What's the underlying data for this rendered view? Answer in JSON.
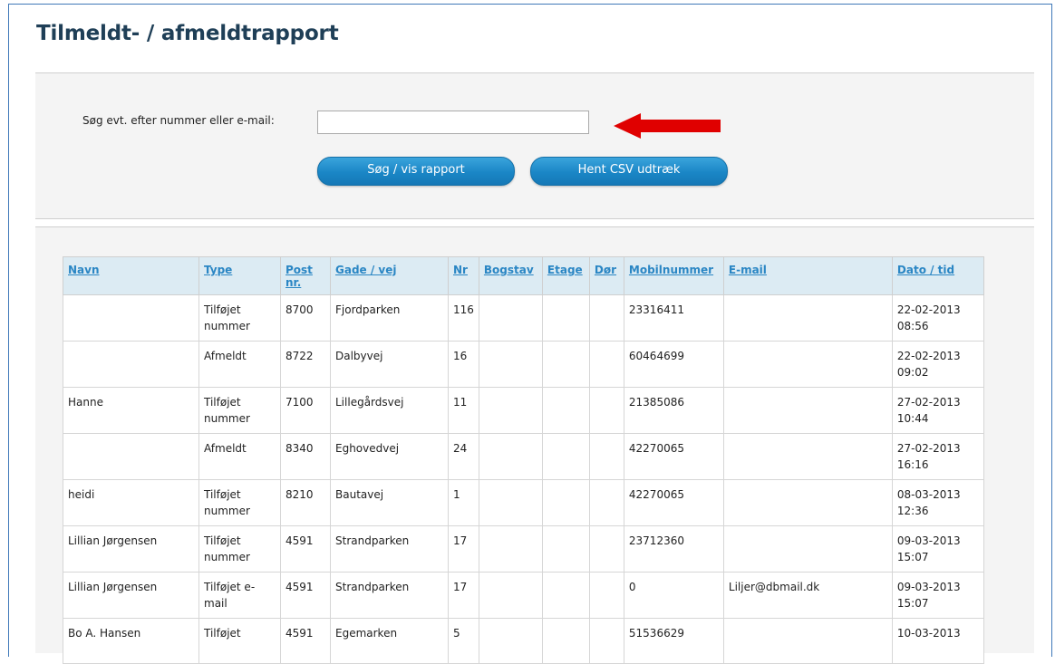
{
  "page": {
    "title": "Tilmeldt- / afmeldtrapport"
  },
  "search": {
    "label": "Søg evt. efter nummer eller e-mail:",
    "value": "",
    "placeholder": "",
    "search_button": "Søg / vis rapport",
    "csv_button": "Hent CSV udtræk"
  },
  "annotation": {
    "arrow_color": "#e00000",
    "icon": "red-arrow-left-icon"
  },
  "table": {
    "headers": [
      "Navn",
      "Type",
      "Post nr.",
      "Gade / vej",
      "Nr",
      "Bogstav",
      "Etage",
      "Dør",
      "Mobilnummer",
      "E-mail",
      "Dato / tid"
    ],
    "rows": [
      [
        "",
        "Tilføjet nummer",
        "8700",
        "Fjordparken",
        "116",
        "",
        "",
        "",
        "23316411",
        "",
        "22-02-2013 08:56"
      ],
      [
        "",
        "Afmeldt",
        "8722",
        "Dalbyvej",
        "16",
        "",
        "",
        "",
        "60464699",
        "",
        "22-02-2013 09:02"
      ],
      [
        "Hanne",
        "Tilføjet nummer",
        "7100",
        "Lillegårdsvej",
        "11",
        "",
        "",
        "",
        "21385086",
        "",
        "27-02-2013 10:44"
      ],
      [
        "",
        "Afmeldt",
        "8340",
        "Eghovedvej",
        "24",
        "",
        "",
        "",
        "42270065",
        "",
        "27-02-2013 16:16"
      ],
      [
        "heidi",
        "Tilføjet nummer",
        "8210",
        "Bautavej",
        "1",
        "",
        "",
        "",
        "42270065",
        "",
        "08-03-2013 12:36"
      ],
      [
        "Lillian Jørgensen",
        "Tilføjet nummer",
        "4591",
        "Strandparken",
        "17",
        "",
        "",
        "",
        "23712360",
        "",
        "09-03-2013 15:07"
      ],
      [
        "Lillian Jørgensen",
        "Tilføjet e-mail",
        "4591",
        "Strandparken",
        "17",
        "",
        "",
        "",
        "0",
        "Liljer@dbmail.dk",
        "09-03-2013 15:07"
      ],
      [
        "Bo A. Hansen",
        "Tilføjet",
        "4591",
        "Egemarken",
        "5",
        "",
        "",
        "",
        "51536629",
        "",
        "10-03-2013"
      ]
    ]
  }
}
